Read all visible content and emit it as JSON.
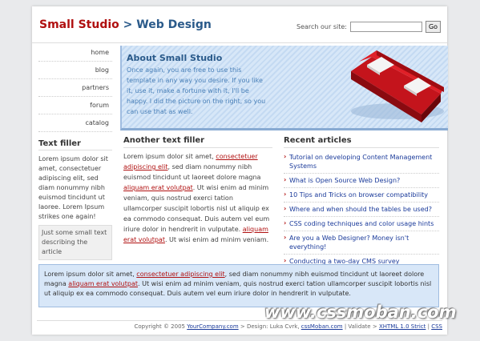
{
  "header": {
    "logo_part1": "Small Studio",
    "logo_sep": " > ",
    "logo_part2": "Web Design",
    "search_label": "Search our site:",
    "search_value": "",
    "search_button": "Go"
  },
  "nav": {
    "items": [
      {
        "label": "home"
      },
      {
        "label": "blog"
      },
      {
        "label": "partners"
      },
      {
        "label": "forum"
      },
      {
        "label": "catalog"
      }
    ]
  },
  "feature": {
    "title": "About Small Studio",
    "text": "Once again, you are free to use this template in any way you desire. If you like it, use it, make a fortune with it, I'll be happy. I did the picture on the right, so you can use that as well."
  },
  "text_filler": {
    "title": "Text filler",
    "body": "Lorem ipsum dolor sit amet, consectetuer adipiscing elit, sed diam nonummy nibh euismod tincidunt ut laoree. Lorem Ipsum strikes one again!",
    "box": "Just some small text describing the article"
  },
  "another": {
    "title": "Another text filler",
    "t1": "Lorem ipsum dolor sit amet, ",
    "l1": "consectetuer adipiscing elit",
    "t2": ", sed diam nonummy nibh euismod tincidunt ut laoreet dolore magna ",
    "l2": "aliquam erat volutpat",
    "t3": ". Ut wisi enim ad minim veniam, quis nostrud exerci tation ullamcorper suscipit lobortis nisl ut aliquip ex ea commodo consequat. Duis autem vel eum iriure dolor in hendrerit in vulputate. ",
    "l3": "aliquam erat volutpat",
    "t4": ". Ut wisi enim ad minim veniam."
  },
  "recent": {
    "title": "Recent articles",
    "items": [
      {
        "label": "Tutorial on developing Content Management Systems"
      },
      {
        "label": "What is Open Source Web Design?"
      },
      {
        "label": "10 Tips and Tricks on browser compatibility"
      },
      {
        "label": "Where and when should the tables be used?"
      },
      {
        "label": "CSS coding techniques and color usage hints"
      },
      {
        "label": "Are you a Web Designer? Money isn't everything!"
      },
      {
        "label": "Conducting a two-day CMS survey"
      }
    ]
  },
  "bottom": {
    "t1": "Lorem ipsum dolor sit amet, ",
    "l1": "consectetuer adipiscing elit",
    "t2": ", sed diam nonummy nibh euismod tincidunt ut laoreet dolore magna ",
    "l2": "aliquam erat volutpat",
    "t3": ". Ut wisi enim ad minim veniam, quis nostrud exerci tation ullamcorper suscipit lobortis nisl ut aliquip ex ea commodo consequat. Duis autem vel eum iriure dolor in hendrerit in vulputate."
  },
  "footer": {
    "copyright": "Copyright © 2005 ",
    "company": "YourCompany.com",
    "design": " > Design: Luka Cvrk, ",
    "design_link": "cssMoban.com",
    "validate": " | Validate > ",
    "xhtml": "XHTML 1.0 Strict",
    "sep": " | ",
    "css": "CSS"
  },
  "watermark": "www.cssmoban.com",
  "colors": {
    "brand_red": "#b01010",
    "brand_blue": "#2a5a8a",
    "link": "#1a3a9a",
    "feature_bg": "#d7e7f8"
  }
}
